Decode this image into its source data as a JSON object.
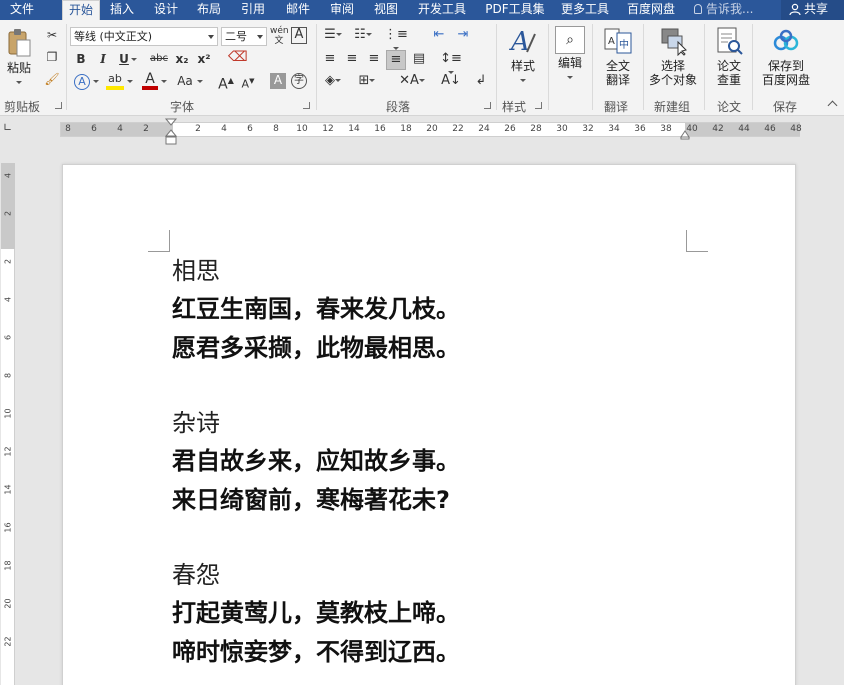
{
  "tabs": [
    "文件",
    "开始",
    "插入",
    "设计",
    "布局",
    "引用",
    "邮件",
    "审阅",
    "视图",
    "开发工具",
    "PDF工具集",
    "更多工具",
    "百度网盘"
  ],
  "active_tab": "开始",
  "tell_me": "告诉我...",
  "share": "共享",
  "ribbon": {
    "clipboard": {
      "paste": "粘贴",
      "label": "剪贴板"
    },
    "font": {
      "name": "等线 (中文正文)",
      "size": "二号",
      "bold": "B",
      "italic": "I",
      "underline": "U",
      "strike": "abc",
      "sub": "x₂",
      "sup": "x²",
      "grow": "A",
      "shrink": "A",
      "case": "Aa",
      "label": "字体"
    },
    "paragraph": {
      "label": "段落"
    },
    "styles": {
      "btn": "样式",
      "label": "样式"
    },
    "editing": {
      "btn": "编辑"
    },
    "translate": {
      "btn1": "全文",
      "btn2": "翻译",
      "label": "翻译"
    },
    "newgroup": {
      "btn1": "选择",
      "btn2": "多个对象",
      "label": "新建组"
    },
    "paper": {
      "btn1": "论文",
      "btn2": "查重",
      "label": "论文"
    },
    "save": {
      "btn1": "保存到",
      "btn2": "百度网盘",
      "label": "保存"
    },
    "accent": "#2b579a"
  },
  "ruler": {
    "h_numbers": [
      "8",
      "6",
      "4",
      "2",
      "2",
      "4",
      "6",
      "8",
      "10",
      "12",
      "14",
      "16",
      "18",
      "20",
      "22",
      "24",
      "26",
      "28",
      "30",
      "32",
      "34",
      "36",
      "38",
      "40",
      "42",
      "44",
      "46",
      "48"
    ],
    "v_numbers": [
      "4",
      "2",
      "2",
      "4",
      "6",
      "8",
      "10",
      "12",
      "14",
      "16",
      "18",
      "20",
      "22"
    ]
  },
  "document": {
    "poems": [
      {
        "title": "相思",
        "lines": [
          "红豆生南国，春来发几枝。",
          "愿君多采撷，此物最相思。"
        ]
      },
      {
        "title": "杂诗",
        "lines": [
          "君自故乡来，应知故乡事。",
          "来日绮窗前，寒梅著花未?"
        ]
      },
      {
        "title": "春怨",
        "lines": [
          "打起黄莺儿，莫教枝上啼。",
          "啼时惊妾梦，不得到辽西。"
        ]
      }
    ]
  }
}
